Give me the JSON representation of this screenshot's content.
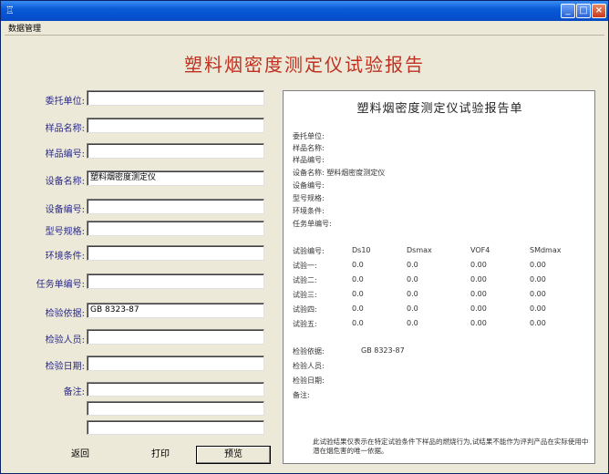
{
  "window": {
    "title_icon": "app-icon",
    "menu": [
      "数据管理"
    ],
    "controls": {
      "minimize": "_",
      "maximize": "□",
      "close": "×"
    }
  },
  "report_title": "塑料烟密度测定仪试验报告",
  "form": {
    "fields": [
      {
        "label": "委托单位:",
        "value": ""
      },
      {
        "label": "样品名称:",
        "value": ""
      },
      {
        "label": "样品编号:",
        "value": ""
      },
      {
        "label": "设备名称:",
        "value": "塑料烟密度测定仪"
      },
      {
        "label": "设备编号:",
        "value": ""
      },
      {
        "label": "型号规格:",
        "value": ""
      },
      {
        "label": "环境条件:",
        "value": ""
      },
      {
        "label": "任务单编号:",
        "value": ""
      },
      {
        "label": "检验依据:",
        "value": "GB 8323-87"
      },
      {
        "label": "检验人员:",
        "value": ""
      },
      {
        "label": "检验日期:",
        "value": ""
      },
      {
        "label": "备注:",
        "value": ""
      }
    ]
  },
  "buttons": {
    "back": "返回",
    "print": "打印",
    "preview": "预览"
  },
  "preview": {
    "title": "塑料烟密度测定仪试验报告单",
    "info_lines": [
      "委托单位:",
      "样品名称:",
      "样品编号:",
      "设备名称: 塑料烟密度测定仪",
      "设备编号:",
      "型号规格:",
      "环境条件:",
      "任务单编号:"
    ],
    "table": {
      "headers": [
        "试验编号:",
        "Ds10",
        "Dsmax",
        "VOF4",
        "SMdmax"
      ],
      "rows": [
        [
          "试验一:",
          "0.0",
          "0.0",
          "0.00",
          "0.00"
        ],
        [
          "试验二:",
          "0.0",
          "0.0",
          "0.00",
          "0.00"
        ],
        [
          "试验三:",
          "0.0",
          "0.0",
          "0.00",
          "0.00"
        ],
        [
          "试验四:",
          "0.0",
          "0.0",
          "0.00",
          "0.00"
        ],
        [
          "试验五:",
          "0.0",
          "0.0",
          "0.00",
          "0.00"
        ]
      ]
    },
    "basis_label": "检验依据:",
    "basis_value": "GB 8323-87",
    "inspector_label": "检验人员:",
    "date_label": "检验日期:",
    "remark_label": "备注:",
    "footer": "此试验结果仅表示在特定试验条件下样品的燃烧行为,试结果不能作为评判产品在实际使用中潜在烟危害的唯一依据。"
  }
}
